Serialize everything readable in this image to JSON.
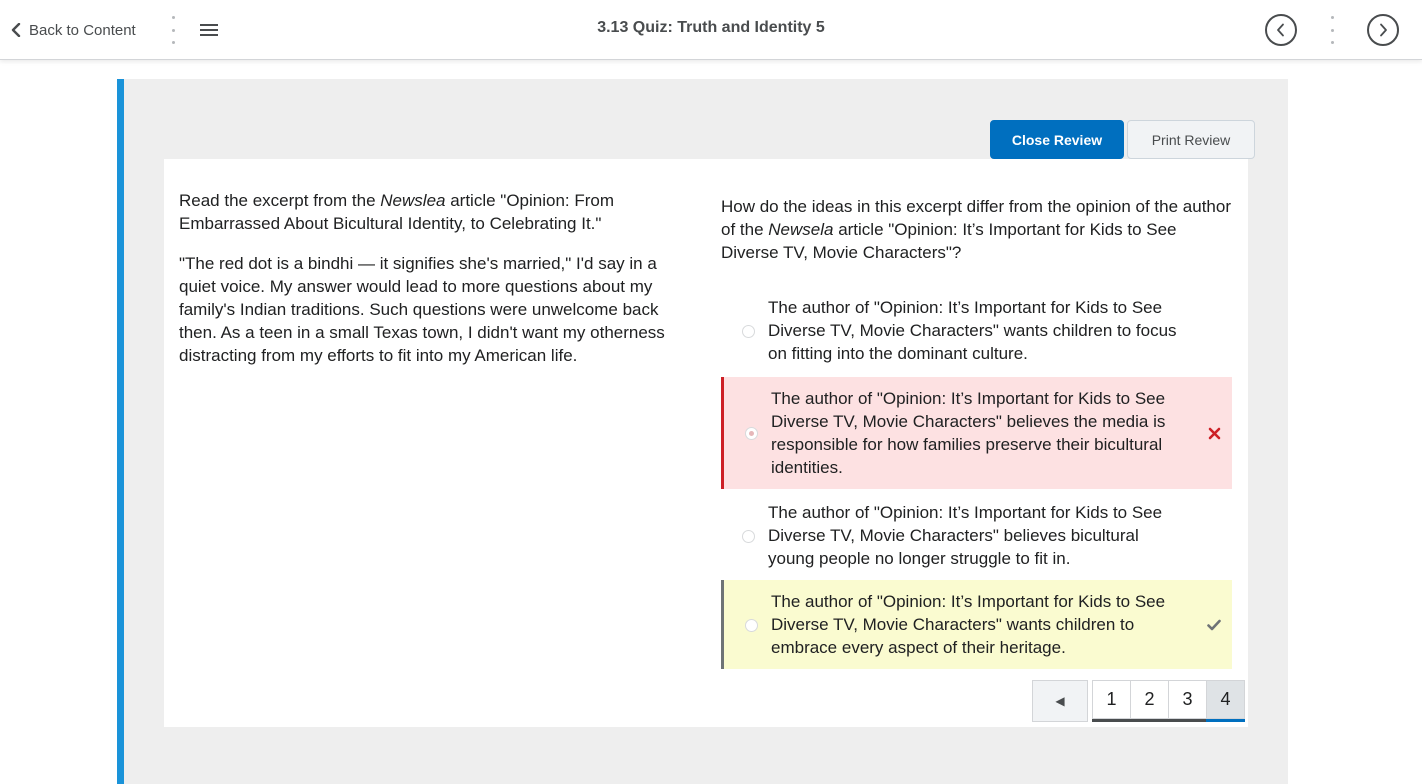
{
  "topbar": {
    "back_label": "Back to Content",
    "title": "3.13 Quiz: Truth and Identity 5"
  },
  "actions": {
    "close_review": "Close Review",
    "print_review": "Print Review"
  },
  "passage": {
    "intro_before": "Read the excerpt from the ",
    "intro_italic": "Newslea",
    "intro_after": " article \"Opinion: From Embarrassed About Bicultural Identity, to Celebrating It.\"",
    "excerpt": "\"The red dot is a bindhi — it signifies she's married,\" I'd say in a quiet voice. My answer would lead to more questions about my family's Indian traditions. Such questions were unwelcome back then. As a teen in a small Texas town, I didn't want my otherness distracting from my efforts to fit into my American life."
  },
  "question": {
    "before": "How do the ideas in this excerpt differ from the opinion of the author of the ",
    "italic": "Newsela",
    "after": " article \"Opinion: It’s Important for Kids to See Diverse TV, Movie Characters\"?"
  },
  "options": [
    {
      "text": "The author of \"Opinion: It’s Important for Kids to See Diverse TV, Movie Characters\" wants children to focus on fitting into the dominant culture.",
      "state": "none"
    },
    {
      "text": "The author of \"Opinion: It’s Important for Kids to See Diverse TV, Movie Characters\" believes the media is responsible for how families preserve their bicultural identities.",
      "state": "incorrect",
      "mark_icon": "x-icon"
    },
    {
      "text": "The author of \"Opinion: It’s Important for Kids to See Diverse TV, Movie Characters\" believes bicultural young people no longer struggle to fit in.",
      "state": "none"
    },
    {
      "text": "The author of \"Opinion: It’s Important for Kids to See Diverse TV, Movie Characters\" wants children to embrace every aspect of their heritage.",
      "state": "correct",
      "mark_icon": "check-icon"
    }
  ],
  "pagination": {
    "prev_symbol": "◀",
    "pages": [
      "1",
      "2",
      "3",
      "4"
    ],
    "current": "4"
  },
  "colors": {
    "accent": "#006fbf",
    "frame_left_border": "#1a93d9",
    "incorrect_bg": "#fde1e2",
    "incorrect_border": "#cd2026",
    "correct_bg": "#fafbd0"
  }
}
